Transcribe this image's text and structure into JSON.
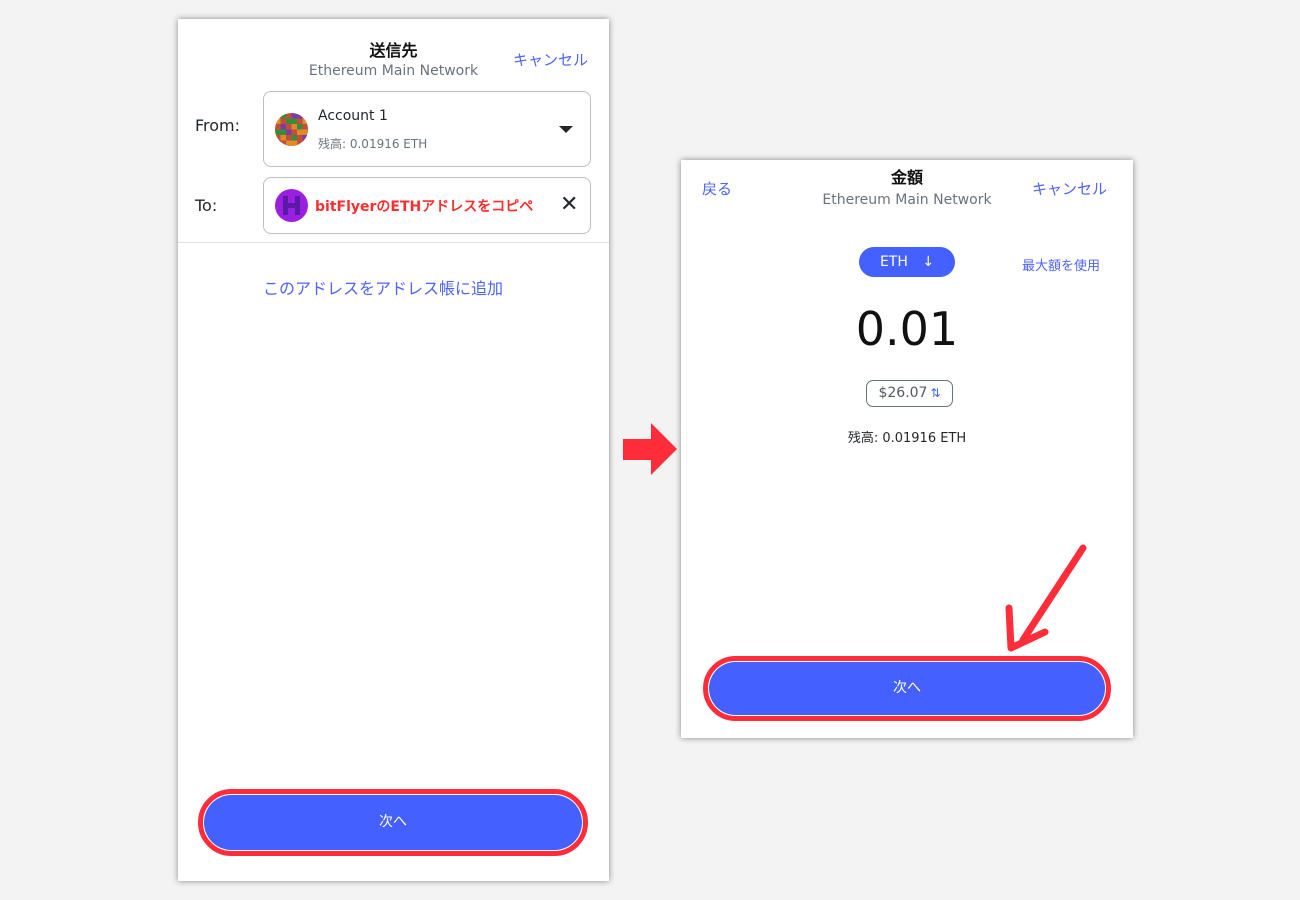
{
  "send_screen": {
    "title": "送信先",
    "network": "Ethereum Main Network",
    "cancel_label": "キャンセル",
    "from_label": "From:",
    "to_label": "To:",
    "account_name": "Account 1",
    "account_balance": "残高: 0.01916 ETH",
    "to_value": "bitFlyerのETHアドレスをコピペ",
    "add_address_link": "このアドレスをアドレス帳に追加",
    "next_label": "次へ"
  },
  "amount_screen": {
    "back_label": "戻る",
    "title": "金額",
    "network": "Ethereum Main Network",
    "cancel_label": "キャンセル",
    "currency_label": "ETH",
    "max_label": "最大額を使用",
    "amount": "0.01",
    "fiat_value": "$26.07",
    "balance": "残高: 0.01916 ETH",
    "next_label": "次へ"
  },
  "colors": {
    "accent_blue": "#4461ff",
    "highlight_red": "#ff2d3a",
    "annotation_text_red": "#ff2d2d"
  },
  "icons": [
    "caret-down-icon",
    "close-icon",
    "arrow-down-icon",
    "swap-icon",
    "right-arrow-annotation",
    "diagonal-arrow-annotation"
  ]
}
